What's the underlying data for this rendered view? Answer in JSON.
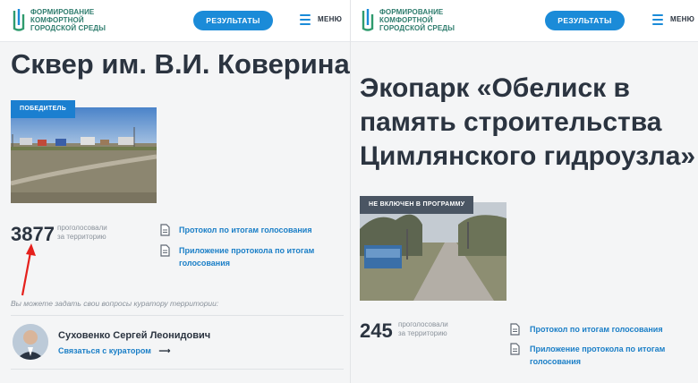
{
  "header": {
    "logo_lines": [
      "Формирование",
      "комфортной",
      "городской среды"
    ],
    "results_label": "РЕЗУЛЬТАТЫ",
    "menu_label": "МЕНЮ"
  },
  "left": {
    "title": "Сквер им. В.И. Коверина.",
    "badge": "ПОБЕДИТЕЛЬ",
    "votes": "3877",
    "votes_caption_1": "проголосовали",
    "votes_caption_2": "за территорию",
    "doc1": "Протокол по итогам голосования",
    "doc2_line1": "Приложение протокола по итогам",
    "doc2_line2": "голосования",
    "question": "Вы можете задать свои вопросы куратору территории:",
    "curator_name": "Суховенко Сергей Леонидович",
    "curator_link": "Связаться с куратором"
  },
  "right": {
    "title_line1": "Экопарк «Обелиск в",
    "title_line2": "память строительства",
    "title_line3": "Цимлянского гидроузла»",
    "badge": "НЕ ВКЛЮЧЕН В ПРОГРАММУ",
    "votes": "245",
    "votes_caption_1": "проголосовали",
    "votes_caption_2": "за территорию",
    "doc1": "Протокол по итогам голосования",
    "doc2_line1": "Приложение протокола по итогам",
    "doc2_line2": "голосования"
  },
  "colors": {
    "accent": "#1b8bd8",
    "winner_badge": "#1b7fd0",
    "excluded_badge": "#4a5563",
    "annotation_arrow": "#e5201c"
  }
}
